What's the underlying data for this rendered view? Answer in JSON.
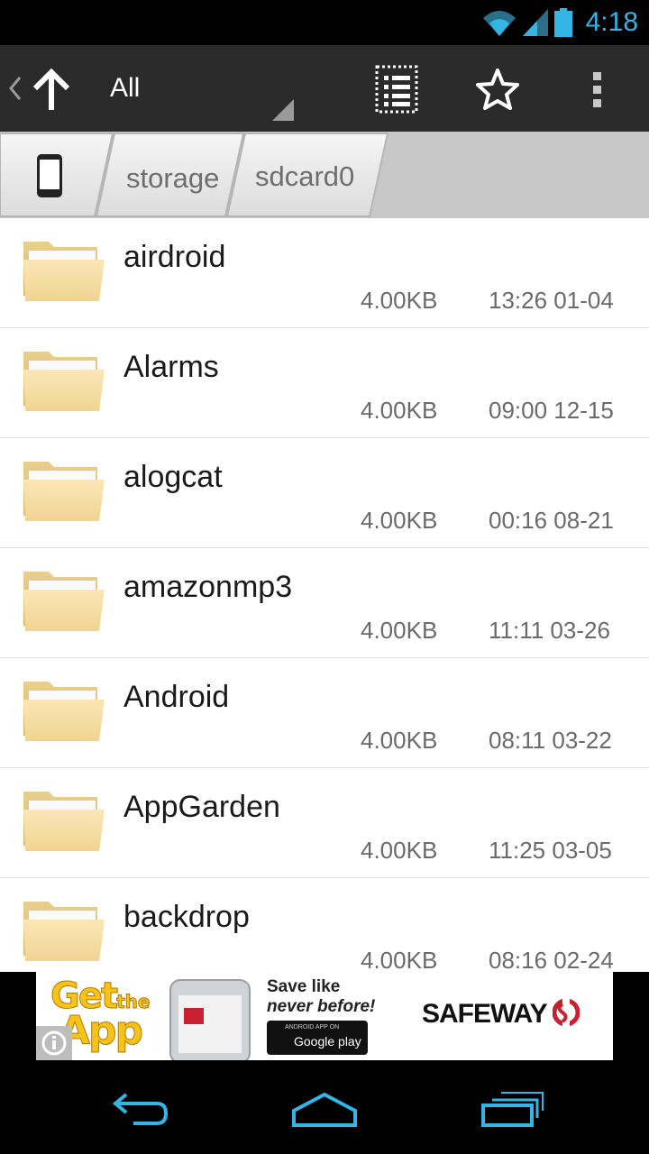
{
  "status_bar": {
    "time": "4:18",
    "icons": [
      "wifi-icon",
      "signal-icon",
      "battery-icon"
    ],
    "accent_color": "#33b5e5"
  },
  "action_bar": {
    "title": "All",
    "icons": [
      "back-chevron-icon",
      "up-arrow-icon",
      "list-view-icon",
      "star-icon",
      "overflow-menu-icon"
    ]
  },
  "breadcrumb": {
    "items": [
      {
        "label": "",
        "icon": "phone-icon"
      },
      {
        "label": "storage"
      },
      {
        "label": "sdcard0"
      }
    ]
  },
  "files": [
    {
      "name": "airdroid",
      "size": "4.00KB",
      "date": "13:26 01-04",
      "icon": "folder-icon"
    },
    {
      "name": "Alarms",
      "size": "4.00KB",
      "date": "09:00 12-15",
      "icon": "folder-icon"
    },
    {
      "name": "alogcat",
      "size": "4.00KB",
      "date": "00:16 08-21",
      "icon": "folder-icon"
    },
    {
      "name": "amazonmp3",
      "size": "4.00KB",
      "date": "11:11 03-26",
      "icon": "folder-icon"
    },
    {
      "name": "Android",
      "size": "4.00KB",
      "date": "08:11 03-22",
      "icon": "folder-icon"
    },
    {
      "name": "AppGarden",
      "size": "4.00KB",
      "date": "11:25 03-05",
      "icon": "folder-icon"
    },
    {
      "name": "backdrop",
      "size": "4.00KB",
      "date": "08:16 02-24",
      "icon": "folder-icon"
    }
  ],
  "ad": {
    "get": "Get",
    "the": "the",
    "app": "App",
    "save_line1": "Save like",
    "save_line2": "never before!",
    "gplay_small": "ANDROID APP ON",
    "gplay_big": "Google play",
    "brand": "SAFEWAY",
    "brand_color": "#c8202f"
  },
  "nav_bar": {
    "icons": [
      "back-nav-icon",
      "home-nav-icon",
      "recents-nav-icon"
    ]
  }
}
